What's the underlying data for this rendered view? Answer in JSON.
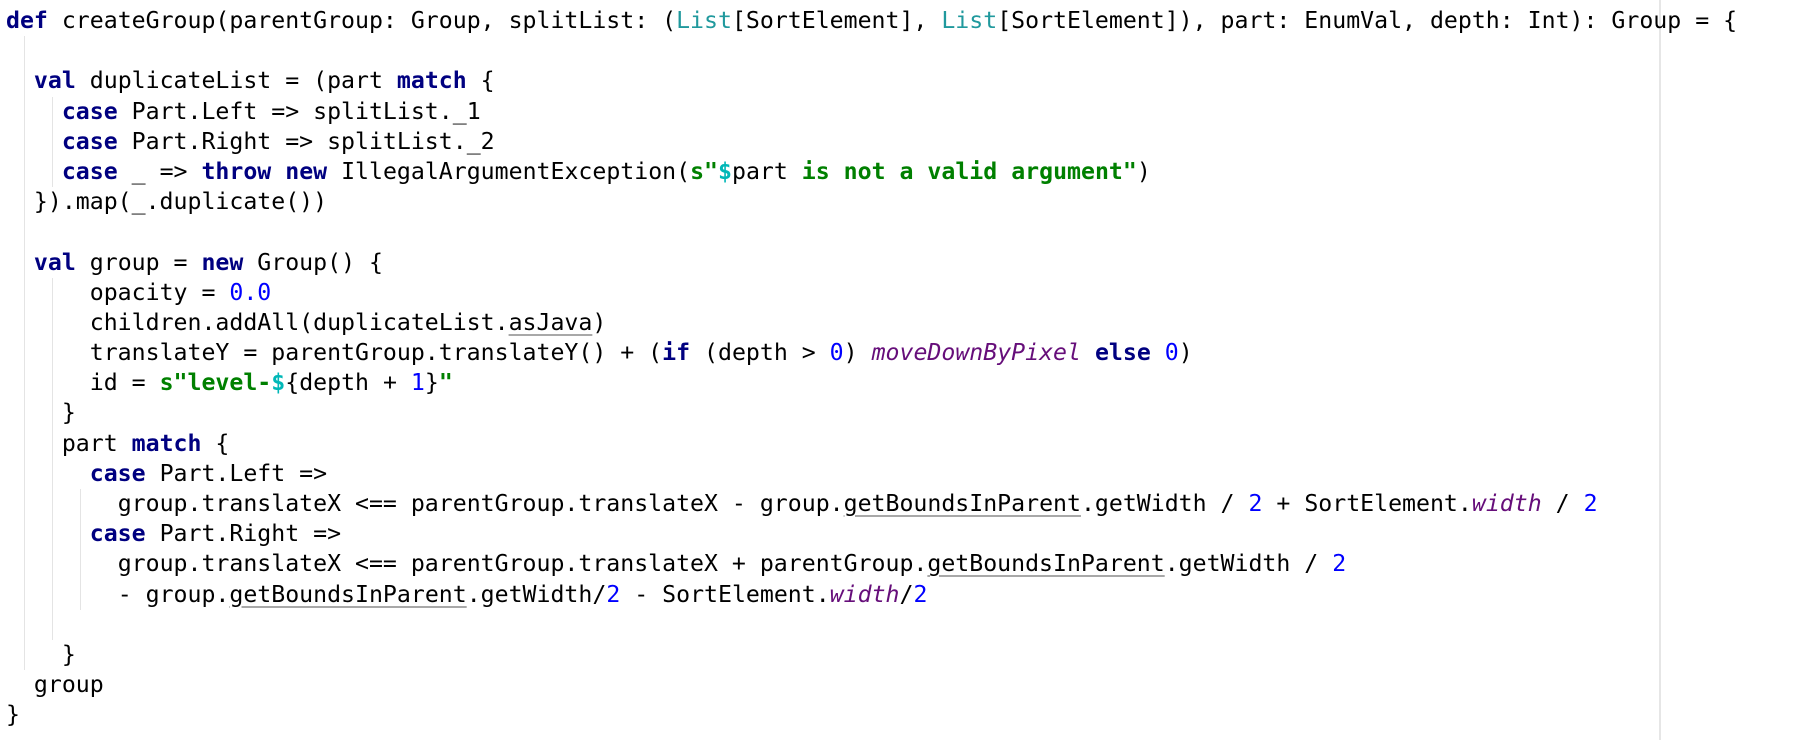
{
  "editor": {
    "language": "scala",
    "colors": {
      "keyword": "#000080",
      "string": "#008000",
      "number": "#0000ff",
      "type": "#20999d",
      "italic_member": "#660e7a",
      "interpolation": "#00b7b7",
      "background": "#ffffff"
    },
    "lines": [
      {
        "indent": 0,
        "tokens": [
          [
            "def",
            "kw"
          ],
          [
            " createGroup(parentGroup: Group, splitList: (",
            ""
          ],
          [
            "List",
            "type"
          ],
          [
            "[SortElement], ",
            ""
          ],
          [
            "List",
            "type"
          ],
          [
            "[SortElement]), part: EnumVal, depth: Int): Group = {",
            ""
          ]
        ]
      },
      {
        "indent": 0,
        "tokens": []
      },
      {
        "indent": 2,
        "tokens": [
          [
            "val",
            "kw"
          ],
          [
            " duplicateList = (part ",
            ""
          ],
          [
            "match",
            "kw"
          ],
          [
            " {",
            ""
          ]
        ]
      },
      {
        "indent": 4,
        "tokens": [
          [
            "case",
            "kw"
          ],
          [
            " Part.Left => splitList._1",
            ""
          ]
        ]
      },
      {
        "indent": 4,
        "tokens": [
          [
            "case",
            "kw"
          ],
          [
            " Part.Right => splitList._2",
            ""
          ]
        ]
      },
      {
        "indent": 4,
        "tokens": [
          [
            "case",
            "kw"
          ],
          [
            " _ => ",
            ""
          ],
          [
            "throw",
            "kw"
          ],
          [
            " ",
            ""
          ],
          [
            "new",
            "kw"
          ],
          [
            " IllegalArgumentException(",
            ""
          ],
          [
            "s\"",
            "str"
          ],
          [
            "$",
            "interp"
          ],
          [
            "part",
            ""
          ],
          [
            " is not a valid argument\"",
            "str"
          ],
          [
            ")",
            ""
          ]
        ]
      },
      {
        "indent": 2,
        "tokens": [
          [
            "}).map(_.duplicate())",
            ""
          ]
        ]
      },
      {
        "indent": 0,
        "tokens": []
      },
      {
        "indent": 2,
        "tokens": [
          [
            "val",
            "kw"
          ],
          [
            " group = ",
            ""
          ],
          [
            "new",
            "kw"
          ],
          [
            " Group() {",
            ""
          ]
        ]
      },
      {
        "indent": 6,
        "tokens": [
          [
            "opacity = ",
            ""
          ],
          [
            "0.0",
            "num"
          ]
        ]
      },
      {
        "indent": 6,
        "tokens": [
          [
            "children.addAll(duplicateList.",
            ""
          ],
          [
            "asJava",
            "ul"
          ],
          [
            ")",
            ""
          ]
        ]
      },
      {
        "indent": 6,
        "tokens": [
          [
            "translateY = parentGroup.translateY() + (",
            ""
          ],
          [
            "if",
            "kw"
          ],
          [
            " (depth > ",
            ""
          ],
          [
            "0",
            "num"
          ],
          [
            ") ",
            ""
          ],
          [
            "moveDownByPixel",
            "ital"
          ],
          [
            " ",
            ""
          ],
          [
            "else",
            "kw"
          ],
          [
            " ",
            ""
          ],
          [
            "0",
            "num"
          ],
          [
            ")",
            ""
          ]
        ]
      },
      {
        "indent": 6,
        "tokens": [
          [
            "id = ",
            ""
          ],
          [
            "s\"level-",
            "str"
          ],
          [
            "$",
            "interp"
          ],
          [
            "{depth + ",
            ""
          ],
          [
            "1",
            "num"
          ],
          [
            "}",
            ""
          ],
          [
            "\"",
            "str"
          ]
        ]
      },
      {
        "indent": 4,
        "tokens": [
          [
            "}",
            ""
          ]
        ]
      },
      {
        "indent": 4,
        "tokens": [
          [
            "part ",
            ""
          ],
          [
            "match",
            "kw"
          ],
          [
            " {",
            ""
          ]
        ]
      },
      {
        "indent": 6,
        "tokens": [
          [
            "case",
            "kw"
          ],
          [
            " Part.Left =>",
            ""
          ]
        ]
      },
      {
        "indent": 8,
        "tokens": [
          [
            "group.translateX <== parentGroup.translateX - group.",
            ""
          ],
          [
            "getBoundsInParent",
            "ul"
          ],
          [
            ".getWidth / ",
            ""
          ],
          [
            "2",
            "num"
          ],
          [
            " + SortElement.",
            ""
          ],
          [
            "width",
            "ital"
          ],
          [
            " / ",
            ""
          ],
          [
            "2",
            "num"
          ]
        ]
      },
      {
        "indent": 6,
        "tokens": [
          [
            "case",
            "kw"
          ],
          [
            " Part.Right =>",
            ""
          ]
        ]
      },
      {
        "indent": 8,
        "tokens": [
          [
            "group.translateX <== parentGroup.translateX + parentGroup.",
            ""
          ],
          [
            "getBoundsInParent",
            "ul"
          ],
          [
            ".getWidth / ",
            ""
          ],
          [
            "2",
            "num"
          ]
        ]
      },
      {
        "indent": 8,
        "tokens": [
          [
            "- group.",
            ""
          ],
          [
            "getBoundsInParent",
            "ul"
          ],
          [
            ".getWidth/",
            ""
          ],
          [
            "2",
            "num"
          ],
          [
            " - SortElement.",
            ""
          ],
          [
            "width",
            "ital"
          ],
          [
            "/",
            ""
          ],
          [
            "2",
            "num"
          ]
        ]
      },
      {
        "indent": 0,
        "tokens": []
      },
      {
        "indent": 4,
        "tokens": [
          [
            "}",
            ""
          ]
        ]
      },
      {
        "indent": 2,
        "tokens": [
          [
            "group",
            ""
          ]
        ]
      },
      {
        "indent": 0,
        "tokens": [
          [
            "}",
            ""
          ]
        ]
      }
    ]
  }
}
